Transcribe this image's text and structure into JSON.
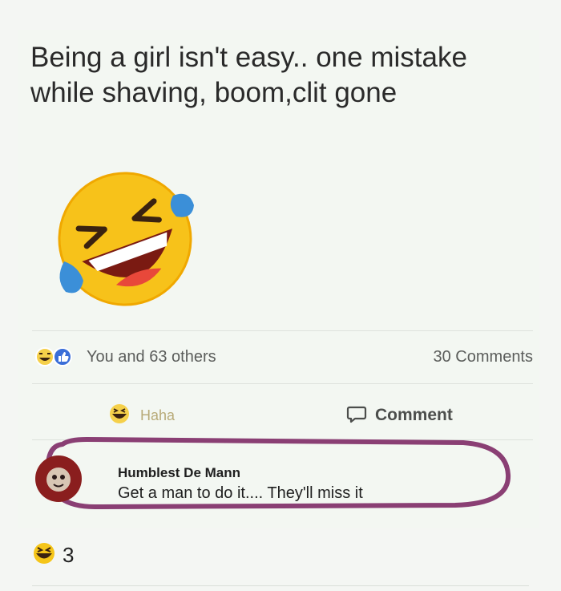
{
  "post": {
    "text_line1": "Being a girl isn't easy.. one mistake",
    "text_line2": "while shaving, boom,clit gone"
  },
  "reactions": {
    "summary": "You and 63 others",
    "comments_count": "30 Comments"
  },
  "actions": {
    "haha_label": "Haha",
    "comment_label": "Comment"
  },
  "comment": {
    "author": "Humblest De Mann",
    "text": "Get a man to do it.... They'll miss it"
  },
  "bottom": {
    "reaction_count": "3"
  },
  "colors": {
    "highlight_ring": "#8a3f74",
    "emoji_face": "#f7c21a",
    "like_blue": "#3a6ed8"
  },
  "icons": {
    "post_emoji": "rolling-on-floor-laughing-icon",
    "reaction_haha": "haha-face-icon",
    "reaction_like": "thumbs-up-icon",
    "comment": "speech-bubble-icon"
  }
}
